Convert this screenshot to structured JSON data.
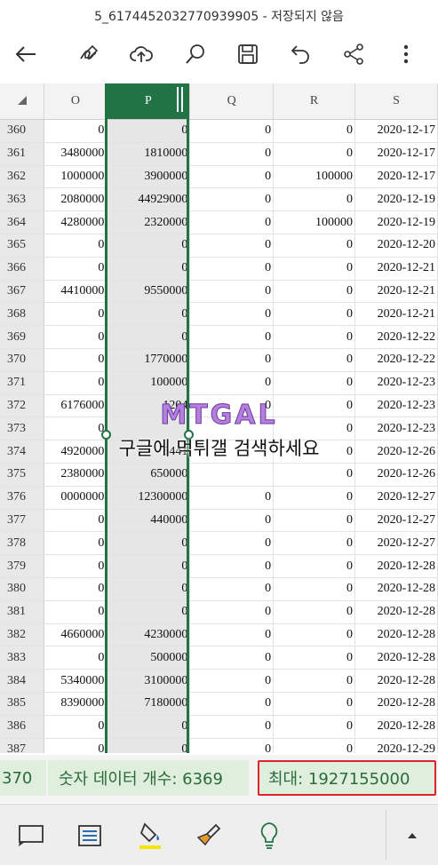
{
  "window": {
    "title": "5_6174452032770939905 - 저장되지 않음"
  },
  "toolbar": {
    "icons": [
      "back-arrow-icon",
      "pen-draw-icon",
      "cloud-upload-icon",
      "search-icon",
      "save-icon",
      "undo-icon",
      "share-icon",
      "more-vertical-icon"
    ]
  },
  "sheet": {
    "columns": [
      "O",
      "P",
      "Q",
      "R",
      "S"
    ],
    "selected_column": "P",
    "rows": [
      {
        "num": "360",
        "O": "0",
        "P": "0",
        "Q": "0",
        "R": "0",
        "S": "2020-12-17"
      },
      {
        "num": "361",
        "O": "3480000",
        "P": "1810000",
        "Q": "0",
        "R": "0",
        "S": "2020-12-17"
      },
      {
        "num": "362",
        "O": "1000000",
        "P": "3900000",
        "Q": "0",
        "R": "100000",
        "S": "2020-12-17"
      },
      {
        "num": "363",
        "O": "2080000",
        "P": "44929000",
        "Q": "0",
        "R": "0",
        "S": "2020-12-19"
      },
      {
        "num": "364",
        "O": "4280000",
        "P": "2320000",
        "Q": "0",
        "R": "100000",
        "S": "2020-12-19"
      },
      {
        "num": "365",
        "O": "0",
        "P": "0",
        "Q": "0",
        "R": "0",
        "S": "2020-12-20"
      },
      {
        "num": "366",
        "O": "0",
        "P": "0",
        "Q": "0",
        "R": "0",
        "S": "2020-12-21"
      },
      {
        "num": "367",
        "O": "4410000",
        "P": "9550000",
        "Q": "0",
        "R": "0",
        "S": "2020-12-21"
      },
      {
        "num": "368",
        "O": "0",
        "P": "0",
        "Q": "0",
        "R": "0",
        "S": "2020-12-21"
      },
      {
        "num": "369",
        "O": "0",
        "P": "0",
        "Q": "0",
        "R": "0",
        "S": "2020-12-22"
      },
      {
        "num": "370",
        "O": "0",
        "P": "1770000",
        "Q": "0",
        "R": "0",
        "S": "2020-12-22"
      },
      {
        "num": "371",
        "O": "0",
        "P": "100000",
        "Q": "0",
        "R": "0",
        "S": "2020-12-23"
      },
      {
        "num": "372",
        "O": "6176000",
        "P": "1204",
        "Q": "0",
        "R": "0",
        "S": "2020-12-23"
      },
      {
        "num": "373",
        "O": "0",
        "P": "",
        "Q": "",
        "R": "0",
        "S": "2020-12-23"
      },
      {
        "num": "374",
        "O": "4920000",
        "P": "5441",
        "Q": "",
        "R": "0",
        "S": "2020-12-26"
      },
      {
        "num": "375",
        "O": "2380000",
        "P": "650000",
        "Q": "",
        "R": "0",
        "S": "2020-12-26"
      },
      {
        "num": "376",
        "O": "0000000",
        "P": "12300000",
        "Q": "0",
        "R": "0",
        "S": "2020-12-27"
      },
      {
        "num": "377",
        "O": "0",
        "P": "440000",
        "Q": "0",
        "R": "0",
        "S": "2020-12-27"
      },
      {
        "num": "378",
        "O": "0",
        "P": "0",
        "Q": "0",
        "R": "0",
        "S": "2020-12-27"
      },
      {
        "num": "379",
        "O": "0",
        "P": "0",
        "Q": "0",
        "R": "0",
        "S": "2020-12-28"
      },
      {
        "num": "380",
        "O": "0",
        "P": "0",
        "Q": "0",
        "R": "0",
        "S": "2020-12-28"
      },
      {
        "num": "381",
        "O": "0",
        "P": "0",
        "Q": "0",
        "R": "0",
        "S": "2020-12-28"
      },
      {
        "num": "382",
        "O": "4660000",
        "P": "4230000",
        "Q": "0",
        "R": "0",
        "S": "2020-12-28"
      },
      {
        "num": "383",
        "O": "0",
        "P": "500000",
        "Q": "0",
        "R": "0",
        "S": "2020-12-28"
      },
      {
        "num": "384",
        "O": "5340000",
        "P": "3100000",
        "Q": "0",
        "R": "0",
        "S": "2020-12-28"
      },
      {
        "num": "385",
        "O": "8390000",
        "P": "7180000",
        "Q": "0",
        "R": "0",
        "S": "2020-12-28"
      },
      {
        "num": "386",
        "O": "0",
        "P": "0",
        "Q": "0",
        "R": "0",
        "S": "2020-12-28"
      },
      {
        "num": "387",
        "O": "0",
        "P": "0",
        "Q": "0",
        "R": "0",
        "S": "2020-12-29"
      }
    ]
  },
  "watermark": {
    "logo": "MTGAL",
    "text": "구글에 먹튀갤 검색하세요"
  },
  "status": {
    "partial": "370",
    "count": "숫자 데이터 개수: 6369",
    "max": "최대: 1927155000"
  },
  "bottom": {
    "icons": [
      "comment-icon",
      "format-cells-icon",
      "fill-color-icon",
      "format-painter-icon",
      "lightbulb-icon",
      "expand-up-icon"
    ],
    "fill_accent": "#f5e600",
    "accent": "#217346"
  }
}
